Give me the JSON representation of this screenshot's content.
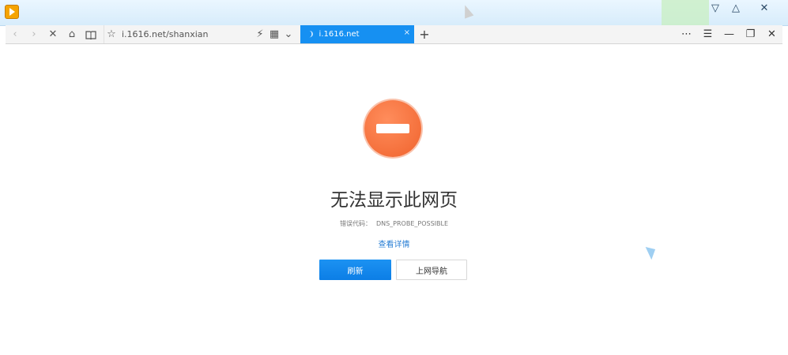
{
  "host_window": {
    "logo_icon": "play-logo-icon",
    "controls": {
      "dropdown": "▽",
      "restore": "△",
      "close": "✕"
    }
  },
  "toolbar": {
    "back_icon": "‹",
    "forward_icon": "›",
    "stop_icon": "✕",
    "home_icon": "⌂",
    "reader_icon": "📖",
    "favorite_icon": "☆",
    "address": "i.1616.net/shanxian",
    "flash_icon": "⚡",
    "qr_icon": "▦",
    "dropdown_icon": "⌄",
    "more_icon": "⋯",
    "menu_icon": "☰",
    "minimize_icon": "—",
    "restore_icon": "❐",
    "close_icon": "✕"
  },
  "tab": {
    "title": "i.1616.net",
    "close_icon": "×"
  },
  "new_tab_icon": "+",
  "error_page": {
    "title": "无法显示此网页",
    "code_label": "错误代码：",
    "code_value": "DNS_PROBE_POSSIBLE",
    "details_link": "查看详情",
    "refresh_button": "刷新",
    "nav_button": "上网导航"
  },
  "colors": {
    "accent": "#1690f2",
    "error_icon": "#f0632d",
    "link": "#2a7fd4"
  }
}
